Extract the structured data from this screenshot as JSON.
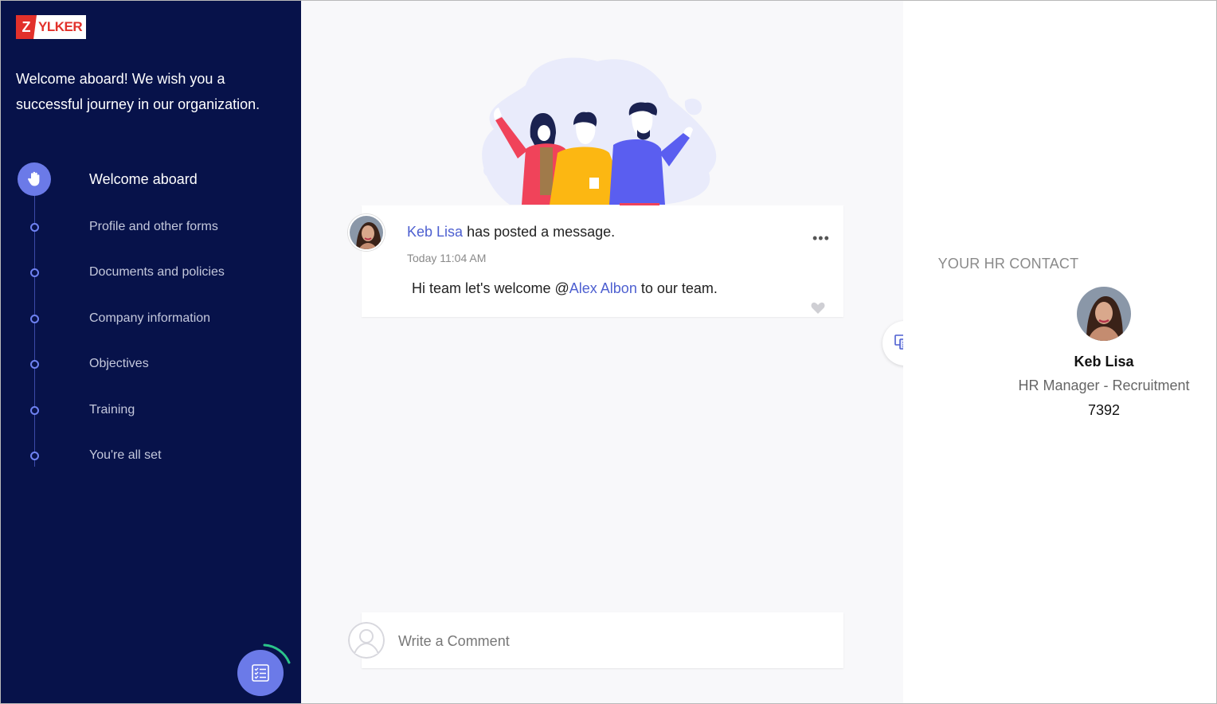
{
  "brand": {
    "logo_letter": "Z",
    "logo_rest": "YLKER",
    "red": "#e2312b"
  },
  "sidebar": {
    "welcome_message": "Welcome aboard! We wish you a successful journey in our organization.",
    "background": "#07124a",
    "accent": "#6b7ae8",
    "steps": [
      {
        "label": "Welcome aboard",
        "active": true,
        "icon": "hand-wave-icon"
      },
      {
        "label": "Profile and other forms"
      },
      {
        "label": "Documents and policies"
      },
      {
        "label": "Company information"
      },
      {
        "label": "Objectives"
      },
      {
        "label": "Training"
      },
      {
        "label": "You're all set"
      }
    ],
    "fab_icon": "checklist-icon"
  },
  "post": {
    "author": "Keb Lisa",
    "action": " has posted a message.",
    "time": "Today 11:04 AM",
    "body_prefix": "Hi team let's welcome @",
    "mention": "Alex Albon",
    "body_suffix": " to our team.",
    "menu": "•••",
    "like_icon": "heart-icon"
  },
  "comment": {
    "placeholder": "Write a Comment"
  },
  "hr_contact": {
    "title": "YOUR HR CONTACT",
    "name": "Keb Lisa",
    "role": "HR Manager - Recruitment",
    "extension": "7392"
  }
}
